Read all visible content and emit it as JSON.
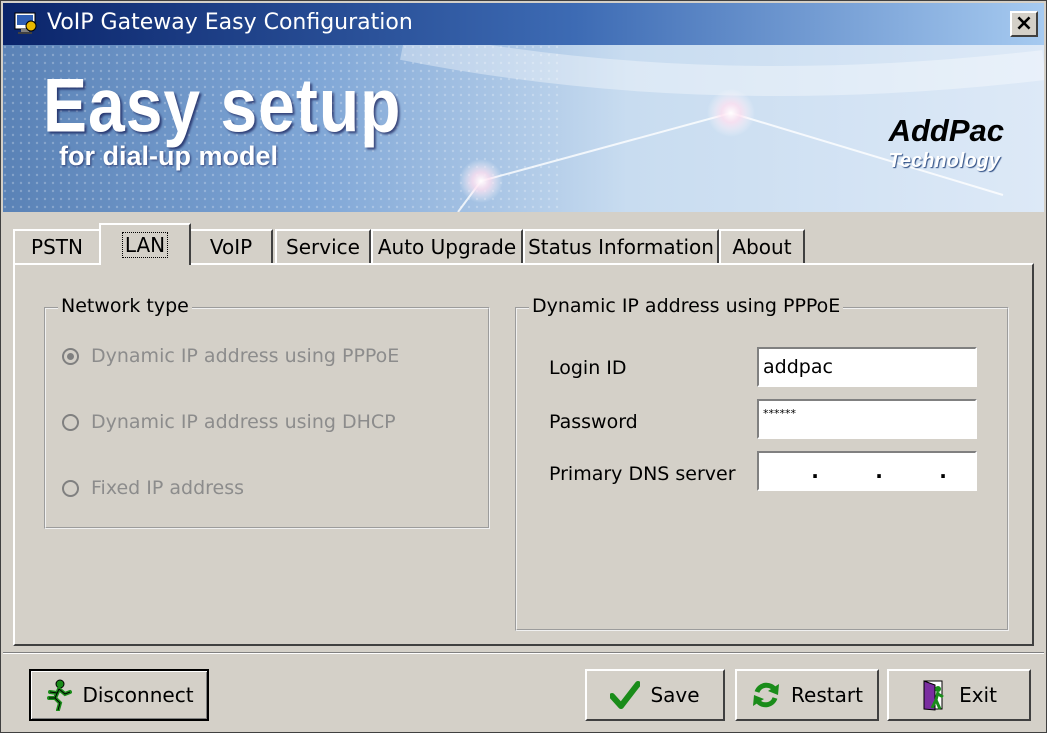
{
  "window": {
    "title": "VoIP Gateway Easy Configuration",
    "close_label": "×"
  },
  "banner": {
    "title": "Easy setup",
    "subtitle": "for dial-up model",
    "brand": "AddPac",
    "brand_sub": "Technology"
  },
  "tabs": [
    "PSTN",
    "LAN",
    "VoIP",
    "Service",
    "Auto Upgrade",
    "Status Information",
    "About"
  ],
  "active_tab": "LAN",
  "network_type": {
    "label": "Network type",
    "options": [
      {
        "label": "Dynamic IP address using PPPoE",
        "checked": true
      },
      {
        "label": "Dynamic IP address using DHCP",
        "checked": false
      },
      {
        "label": "Fixed IP address",
        "checked": false
      }
    ]
  },
  "pppoe": {
    "label": "Dynamic IP address using PPPoE",
    "login_label": "Login ID",
    "login_value": "addpac",
    "password_label": "Password",
    "password_value": "******",
    "dns_label": "Primary DNS server",
    "dns_dots": [
      ".",
      ".",
      "."
    ]
  },
  "buttons": {
    "disconnect": "Disconnect",
    "save": "Save",
    "restart": "Restart",
    "exit": "Exit"
  },
  "icons": {
    "app": "app-icon",
    "disconnect": "running-man-icon",
    "save": "checkmark-icon",
    "restart": "refresh-icon",
    "exit": "exit-door-icon"
  },
  "colors": {
    "titlebar_start": "#0a246a",
    "titlebar_end": "#a6caf0",
    "face": "#d4d0c8",
    "disabled_text": "#8c8c8c",
    "check_green": "#1a8c1a"
  }
}
